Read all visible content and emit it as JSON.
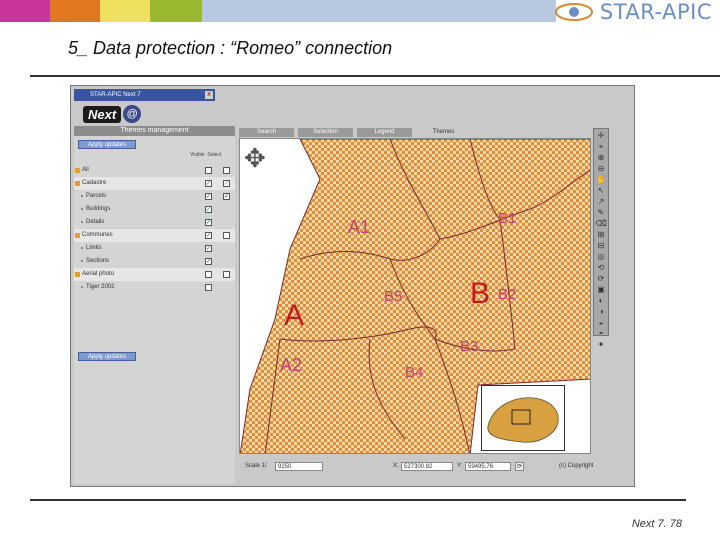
{
  "slide": {
    "title": "5_ Data protection : “Romeo” connection",
    "footer": "Next 7. 78",
    "brand": "STAR-APIC",
    "topbar_colors": [
      "#c8359a",
      "#e07820",
      "#2a78c8",
      "#f0e060",
      "#9ab830",
      "#b8c8e0"
    ]
  },
  "window": {
    "title": "STAR-APIC Next 7",
    "close": "x",
    "logo_next": "Next",
    "logo_at": "@"
  },
  "panel": {
    "header": "Themes management",
    "apply_top": "Apply updates",
    "apply_bottom": "Apply updates",
    "col_visible": "Visible",
    "col_select": "Select",
    "rows": [
      {
        "label": "All",
        "a": "",
        "b": ""
      },
      {
        "label": "Cadastre",
        "a": "✓",
        "b": "✓"
      },
      {
        "label": "Parcels",
        "a": "✓",
        "b": "✓"
      },
      {
        "label": "Buildings",
        "a": "✓",
        "b": ""
      },
      {
        "label": "Details",
        "a": "✓",
        "b": ""
      },
      {
        "label": "Communes",
        "a": "✓",
        "b": ""
      },
      {
        "label": "Limits",
        "a": "✓",
        "b": ""
      },
      {
        "label": "Sections",
        "a": "✓",
        "b": ""
      },
      {
        "label": "Aerial photo",
        "a": "",
        "b": ""
      },
      {
        "label": "Tiger 2002",
        "a": "",
        "b": ""
      }
    ]
  },
  "tabs": [
    "Search",
    "Selection",
    "Legend",
    "Themes"
  ],
  "map": {
    "fill": "#e8a65a",
    "big_labels": [
      "A",
      "B"
    ],
    "zone_labels": [
      "A1",
      "A2",
      "B1",
      "B2",
      "B3",
      "B4",
      "B5"
    ],
    "big_label_color": "#c41a1a",
    "zone_label_color": "#c84070"
  },
  "tools": [
    "✛",
    "⌖",
    "⊕",
    "⊖",
    "✋",
    "↖",
    "↗",
    "✎",
    "⌫",
    "⊞",
    "⊟",
    "◎",
    "⟲",
    "⟳",
    "▣",
    "◐",
    "◑",
    "◒",
    "◓",
    "✦"
  ],
  "status": {
    "scale_label": "Scale 1/",
    "scale_value": "9250",
    "x_label": "X:",
    "x_value": "527300.82",
    "y_label": "Y:",
    "y_value": "59495.76",
    "copyright": "(c) Copyright"
  }
}
